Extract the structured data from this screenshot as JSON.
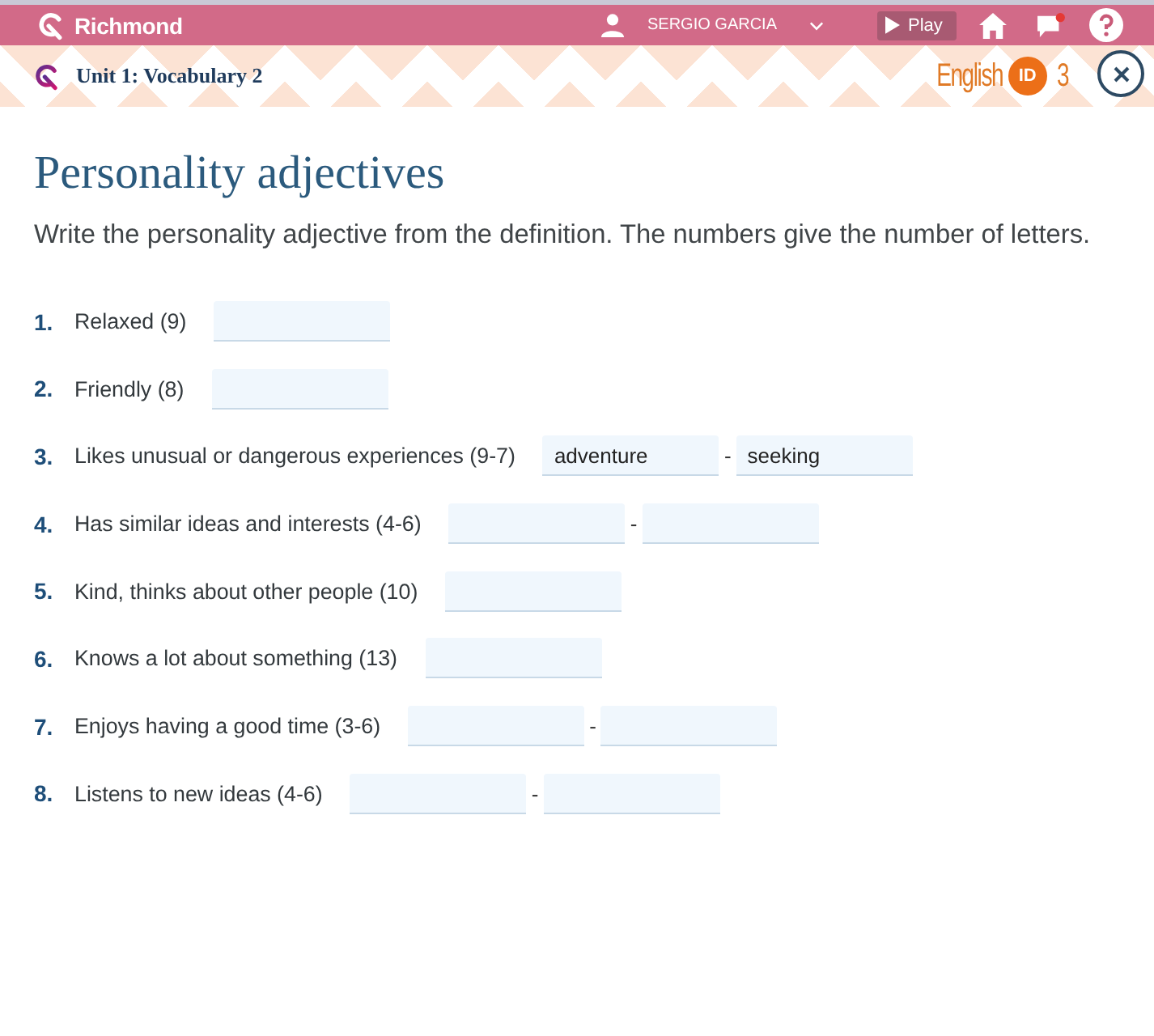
{
  "top_bar": {
    "dimmed": true,
    "brand": "Richmond",
    "user_name": "SERGIO GARCIA",
    "play_button": "Play"
  },
  "banner": {
    "unit_title": "Unit 1: Vocabulary 2",
    "course_logo": {
      "name": "English",
      "badge": "ID",
      "level": "3"
    }
  },
  "exercise": {
    "title": "Personality adjectives",
    "instruction": "Write the personality adjective from the definition. The numbers give the number of letters.",
    "items": [
      {
        "number": "1.",
        "prompt": "Relaxed (9)",
        "parts": [
          {
            "kind": "field"
          }
        ]
      },
      {
        "number": "2.",
        "prompt": "Friendly (8)",
        "parts": [
          {
            "kind": "field"
          }
        ]
      },
      {
        "number": "3.",
        "prompt": "Likes unusual or dangerous experiences (9-7)",
        "parts": [
          {
            "kind": "field",
            "value": "adventure"
          },
          {
            "kind": "separator",
            "text": "-"
          },
          {
            "kind": "field",
            "value": "seeking"
          }
        ]
      },
      {
        "number": "4.",
        "prompt": "Has similar ideas and interests (4-6)",
        "parts": [
          {
            "kind": "field"
          },
          {
            "kind": "separator",
            "text": "-"
          },
          {
            "kind": "field"
          }
        ]
      },
      {
        "number": "5.",
        "prompt": "Kind, thinks about other people (10)",
        "parts": [
          {
            "kind": "field"
          }
        ]
      },
      {
        "number": "6.",
        "prompt": "Knows a lot about something (13)",
        "parts": [
          {
            "kind": "field"
          }
        ]
      },
      {
        "number": "7.",
        "prompt": "Enjoys having a good time (3-6)",
        "parts": [
          {
            "kind": "field"
          },
          {
            "kind": "separator",
            "text": "-"
          },
          {
            "kind": "field"
          }
        ]
      },
      {
        "number": "8.",
        "prompt": "Listens to new ideas (4-6)",
        "parts": [
          {
            "kind": "field"
          },
          {
            "kind": "separator",
            "text": "-"
          },
          {
            "kind": "field"
          }
        ]
      }
    ]
  }
}
